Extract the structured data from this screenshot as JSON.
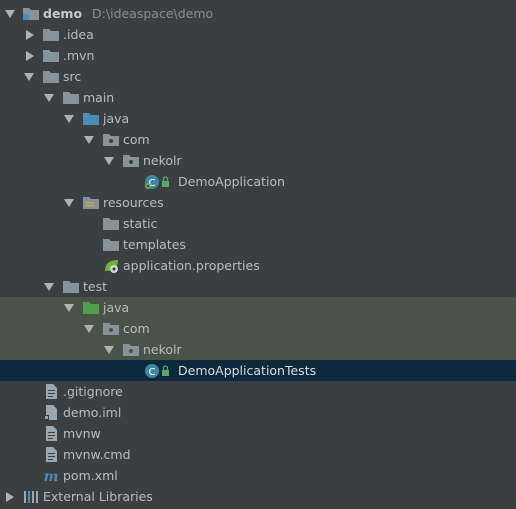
{
  "project": {
    "name": "demo",
    "path": "D:\\ideaspace\\demo"
  },
  "tree": {
    "idea": ".idea",
    "mvn": ".mvn",
    "src": "src",
    "main": "main",
    "main_java": "java",
    "main_com": "com",
    "main_nekolr": "nekolr",
    "demo_app": "DemoApplication",
    "resources": "resources",
    "static": "static",
    "templates": "templates",
    "app_props": "application.properties",
    "test": "test",
    "test_java": "java",
    "test_com": "com",
    "test_nekolr": "nekolr",
    "demo_app_tests": "DemoApplicationTests",
    "gitignore": ".gitignore",
    "demo_iml": "demo.iml",
    "mvnw": "mvnw",
    "mvnw_cmd": "mvnw.cmd",
    "pom": "pom.xml",
    "ext_libs": "External Libraries"
  },
  "colors": {
    "background": "#3c3f41",
    "text": "#bbbbbb",
    "folder": "#87939a",
    "source_folder": "#4a8bb8",
    "test_folder": "#4e9e4a",
    "test_highlight": "#4a5348",
    "selection": "#0d293e"
  },
  "icons": {
    "module": "module-folder-icon",
    "folder": "folder-icon",
    "source_root": "source-root-icon",
    "test_root": "test-root-icon",
    "resources_root": "resources-root-icon",
    "package": "package-icon",
    "spring_class": "spring-boot-class-icon",
    "spring_config": "spring-config-icon",
    "file": "text-file-icon",
    "maven": "maven-icon",
    "libraries": "libraries-icon"
  }
}
